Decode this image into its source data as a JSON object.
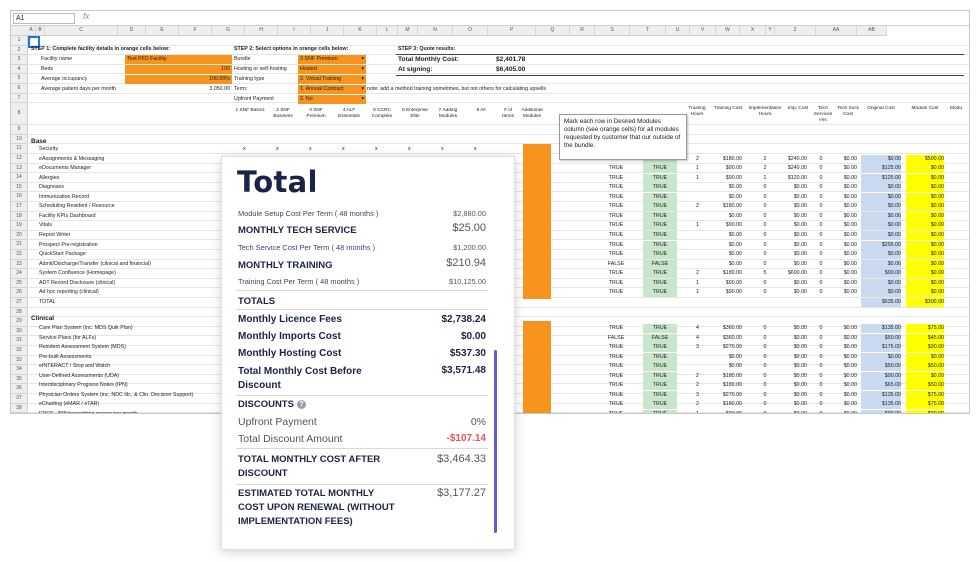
{
  "formula_bar": {
    "cell_ref": "A1",
    "fx": "fx"
  },
  "columns": [
    "A",
    "B",
    "C",
    "D",
    "E",
    "F",
    "G",
    "H",
    "I",
    "J",
    "K",
    "L",
    "M",
    "N",
    "O",
    "P",
    "Q",
    "R",
    "S",
    "T",
    "U",
    "V",
    "W",
    "X",
    "Y",
    "Z",
    "AA",
    "AB"
  ],
  "rows": [
    "1",
    "2",
    "3",
    "4",
    "5",
    "6",
    "7",
    "8",
    "9",
    "10",
    "11",
    "12",
    "13",
    "14",
    "15",
    "16",
    "17",
    "18",
    "19",
    "20",
    "21",
    "22",
    "23",
    "24",
    "25",
    "26",
    "27",
    "28",
    "29",
    "30",
    "31",
    "32",
    "33",
    "34",
    "35",
    "36",
    "37",
    "38",
    "39"
  ],
  "step1": {
    "title": "STEP 1: Complete facility details in orange cells below:",
    "facility_label": "Facility name",
    "facility_value": "Test PFD Facility",
    "beds_label": "Beds",
    "beds_value": "100",
    "occupancy_label": "Average occupancy",
    "occupancy_value": "100.00%",
    "patient_days_label": "Average patient days per month",
    "patient_days_value": "3,050.00"
  },
  "step2": {
    "title": "STEP 2: Select options in orange cells below:",
    "bundle_label": "Bundle",
    "bundle_value": "3 SNF Premium",
    "hosting_label": "Hosting or self-hosting",
    "hosting_value": "Hosted",
    "training_label": "Training type",
    "training_value": "2. Virtual Training",
    "term_label": "Term:",
    "term_value": "1. Annual Contract",
    "upfront_label": "Upfront Payment",
    "upfront_value": "2. No",
    "note": "note: add a method training sometimes, but not others for calculating upsells"
  },
  "step3": {
    "title": "STEP 3: Quote results:",
    "monthly_label": "Total Monthly Cost:",
    "monthly_value": "$2,401.78",
    "signing_label": "At signing:",
    "signing_value": "$6,405.00"
  },
  "bundle_headers": [
    "1 SNF Basics",
    "2 SNF Business",
    "3 SNF Premium",
    "4 ALF Essentials",
    "5 CCRC Complete",
    "6 Enterprise Elite",
    "7 Adding Modules",
    "8 All",
    "# of Items",
    "Additional Modules"
  ],
  "right_headers": [
    "Training Hours",
    "Training Cost",
    "Implementation Hours",
    "Imp. Cost",
    "Tech Services Hrs",
    "Tech Svcs Cost",
    "Original Cost",
    "Module Cost",
    "Modu"
  ],
  "tooltip": "Mark each row in Desired Modules column (see orange cells) for all modules requested by customer that our outside of the bundle.",
  "section_base": "Base",
  "section_clinical": "Clinical",
  "base_modules": [
    "Security",
    "eAssignments & Messaging",
    "eDocuments Manager",
    "Allergies",
    "Diagnoses",
    "Immunization Record",
    "Scheduling Resident / Resource",
    "Facility KPIs Dashboard",
    "Vitals",
    "Report Writer",
    "Prospect Pre-registration",
    "QuickStart Package",
    "Admit/Discharge/Transfer (clinical and financial)",
    "System Confluence (Homepage)",
    "ADT Record Disclosure (clinical)",
    "Ad hoc reporting (clinical)",
    "TOTAL"
  ],
  "clinical_modules": [
    "Care Plan System (inc. MDS Quik Plan)",
    "Service Plans (for ALFs)",
    "Resident Assessment System (MDS)",
    "Pre-built Assessments",
    "eINTERACT / Stop and Watch",
    "User-Defined Assessments (UDA)",
    "Interdisciplinary Progress Notes (IPN)",
    "Physician Orders System (inc. NDC lib., & Clin. Decision Support)",
    "eCharting (eMAR / eTAR)",
    "EPCS - $65/prescribing person per month"
  ],
  "base_data": [
    [
      "",
      "",
      "",
      "",
      "$0.00",
      "$0.00",
      "$0.00",
      "$0.00",
      "$0.00"
    ],
    [
      "TRUE",
      "TRUE",
      "2",
      "$180.00",
      "2",
      "$240.00",
      "0",
      "$0.00",
      "$0.00",
      "$500.00"
    ],
    [
      "TRUE",
      "TRUE",
      "1",
      "$90.00",
      "2",
      "$240.00",
      "0",
      "$0.00",
      "$125.00",
      "$0.00"
    ],
    [
      "TRUE",
      "TRUE",
      "1",
      "$90.00",
      "1",
      "$120.00",
      "0",
      "$0.00",
      "$125.00",
      "$0.00"
    ],
    [
      "TRUE",
      "TRUE",
      "",
      "$0.00",
      "0",
      "$0.00",
      "0",
      "$0.00",
      "$0.00",
      "$0.00"
    ],
    [
      "TRUE",
      "TRUE",
      "",
      "$0.00",
      "0",
      "$0.00",
      "0",
      "$0.00",
      "$0.00",
      "$0.00"
    ],
    [
      "TRUE",
      "TRUE",
      "2",
      "$180.00",
      "0",
      "$0.00",
      "0",
      "$0.00",
      "$0.00",
      "$0.00"
    ],
    [
      "TRUE",
      "TRUE",
      "",
      "$0.00",
      "0",
      "$0.00",
      "0",
      "$0.00",
      "$0.00",
      "$0.00"
    ],
    [
      "TRUE",
      "TRUE",
      "1",
      "$90.00",
      "0",
      "$0.00",
      "0",
      "$0.00",
      "$0.00",
      "$0.00"
    ],
    [
      "TRUE",
      "TRUE",
      "",
      "$0.00",
      "0",
      "$0.00",
      "0",
      "$0.00",
      "$0.00",
      "$0.00"
    ],
    [
      "TRUE",
      "TRUE",
      "",
      "$0.00",
      "0",
      "$0.00",
      "0",
      "$0.00",
      "$295.00",
      "$0.00"
    ],
    [
      "TRUE",
      "TRUE",
      "",
      "$0.00",
      "0",
      "$0.00",
      "0",
      "$0.00",
      "$0.00",
      "$0.00"
    ],
    [
      "FALSE",
      "FALSE",
      "",
      "$0.00",
      "0",
      "$0.00",
      "0",
      "$0.00",
      "$0.00",
      "$0.00"
    ],
    [
      "TRUE",
      "TRUE",
      "2",
      "$180.00",
      "5",
      "$600.00",
      "0",
      "$0.00",
      "$90.00",
      "$0.00"
    ],
    [
      "TRUE",
      "TRUE",
      "1",
      "$90.00",
      "0",
      "$0.00",
      "0",
      "$0.00",
      "$0.00",
      "$0.00"
    ],
    [
      "TRUE",
      "TRUE",
      "1",
      "$90.00",
      "0",
      "$0.00",
      "0",
      "$0.00",
      "$0.00",
      "$0.00"
    ],
    [
      "",
      "",
      "",
      "",
      "",
      "",
      "",
      "",
      "$635.00",
      "$300.00"
    ]
  ],
  "clinical_data": [
    [
      "TRUE",
      "TRUE",
      "4",
      "$360.00",
      "0",
      "$0.00",
      "0",
      "$0.00",
      "$135.00",
      "$75.00"
    ],
    [
      "FALSE",
      "FALSE",
      "4",
      "$360.00",
      "0",
      "$0.00",
      "0",
      "$0.00",
      "$50.00",
      "$45.00"
    ],
    [
      "TRUE",
      "TRUE",
      "3",
      "$270.00",
      "0",
      "$0.00",
      "0",
      "$0.00",
      "$175.00",
      "$90.00"
    ],
    [
      "TRUE",
      "TRUE",
      "",
      "$0.00",
      "0",
      "$0.00",
      "0",
      "$0.00",
      "$0.00",
      "$0.00"
    ],
    [
      "TRUE",
      "TRUE",
      "",
      "$0.00",
      "0",
      "$0.00",
      "0",
      "$0.00",
      "$50.00",
      "$50.00"
    ],
    [
      "TRUE",
      "TRUE",
      "2",
      "$180.00",
      "0",
      "$0.00",
      "0",
      "$0.00",
      "$90.00",
      "$0.00"
    ],
    [
      "TRUE",
      "TRUE",
      "2",
      "$180.00",
      "0",
      "$0.00",
      "0",
      "$0.00",
      "$65.00",
      "$50.00"
    ],
    [
      "TRUE",
      "TRUE",
      "3",
      "$270.00",
      "0",
      "$0.00",
      "0",
      "$0.00",
      "$135.00",
      "$75.00"
    ],
    [
      "TRUE",
      "TRUE",
      "2",
      "$180.00",
      "0",
      "$0.00",
      "0",
      "$0.00",
      "$135.00",
      "$75.00"
    ],
    [
      "TRUE",
      "TRUE",
      "1",
      "$90.00",
      "0",
      "$0.00",
      "0",
      "$0.00",
      "$90.00",
      "$90.00"
    ]
  ],
  "card": {
    "title": "Total",
    "setup_label": "Module Setup Cost Per Term ( 48 months )",
    "setup_value": "$2,880.00",
    "tech_label": "MONTHLY TECH SERVICE",
    "tech_value": "$25.00",
    "tech_term_label": "Tech Service Cost Per Term ( 48 months )",
    "tech_term_value": "$1,200.00",
    "training_label": "MONTHLY TRAINING",
    "training_value": "$210.94",
    "training_term_label": "Training Cost Per Term ( 48 months )",
    "training_term_value": "$10,125.00",
    "totals_label": "TOTALS",
    "licence_label": "Monthly Licence Fees",
    "licence_value": "$2,738.24",
    "imports_label": "Monthly Imports Cost",
    "imports_value": "$0.00",
    "hosting_label": "Monthly Hosting Cost",
    "hosting_value": "$537.30",
    "before_discount_label_1": "Total Monthly Cost Before",
    "before_discount_label_2": "Discount",
    "before_discount_value": "$3,571.48",
    "discounts_label": "DISCOUNTS",
    "upfront_label": "Upfront Payment",
    "upfront_value": "0%",
    "discount_amount_label": "Total Discount Amount",
    "discount_amount_value": "-$107.14",
    "after_label_1": "TOTAL MONTHLY COST AFTER",
    "after_label_2": "DISCOUNT",
    "after_value": "$3,464.33",
    "renewal_label_1": "ESTIMATED TOTAL MONTHLY",
    "renewal_label_2": "COST UPON RENEWAL (WITHOUT",
    "renewal_label_3": "IMPLEMENTATION FEES)",
    "renewal_value": "$3,177.27"
  },
  "colors": {
    "orange": "#f7941d",
    "green": "#c7e6cc",
    "blue": "#c9daf0",
    "yellow": "#ffff00",
    "navy": "#1b2346",
    "red": "#e0575f",
    "scroll": "#6a5acd"
  }
}
